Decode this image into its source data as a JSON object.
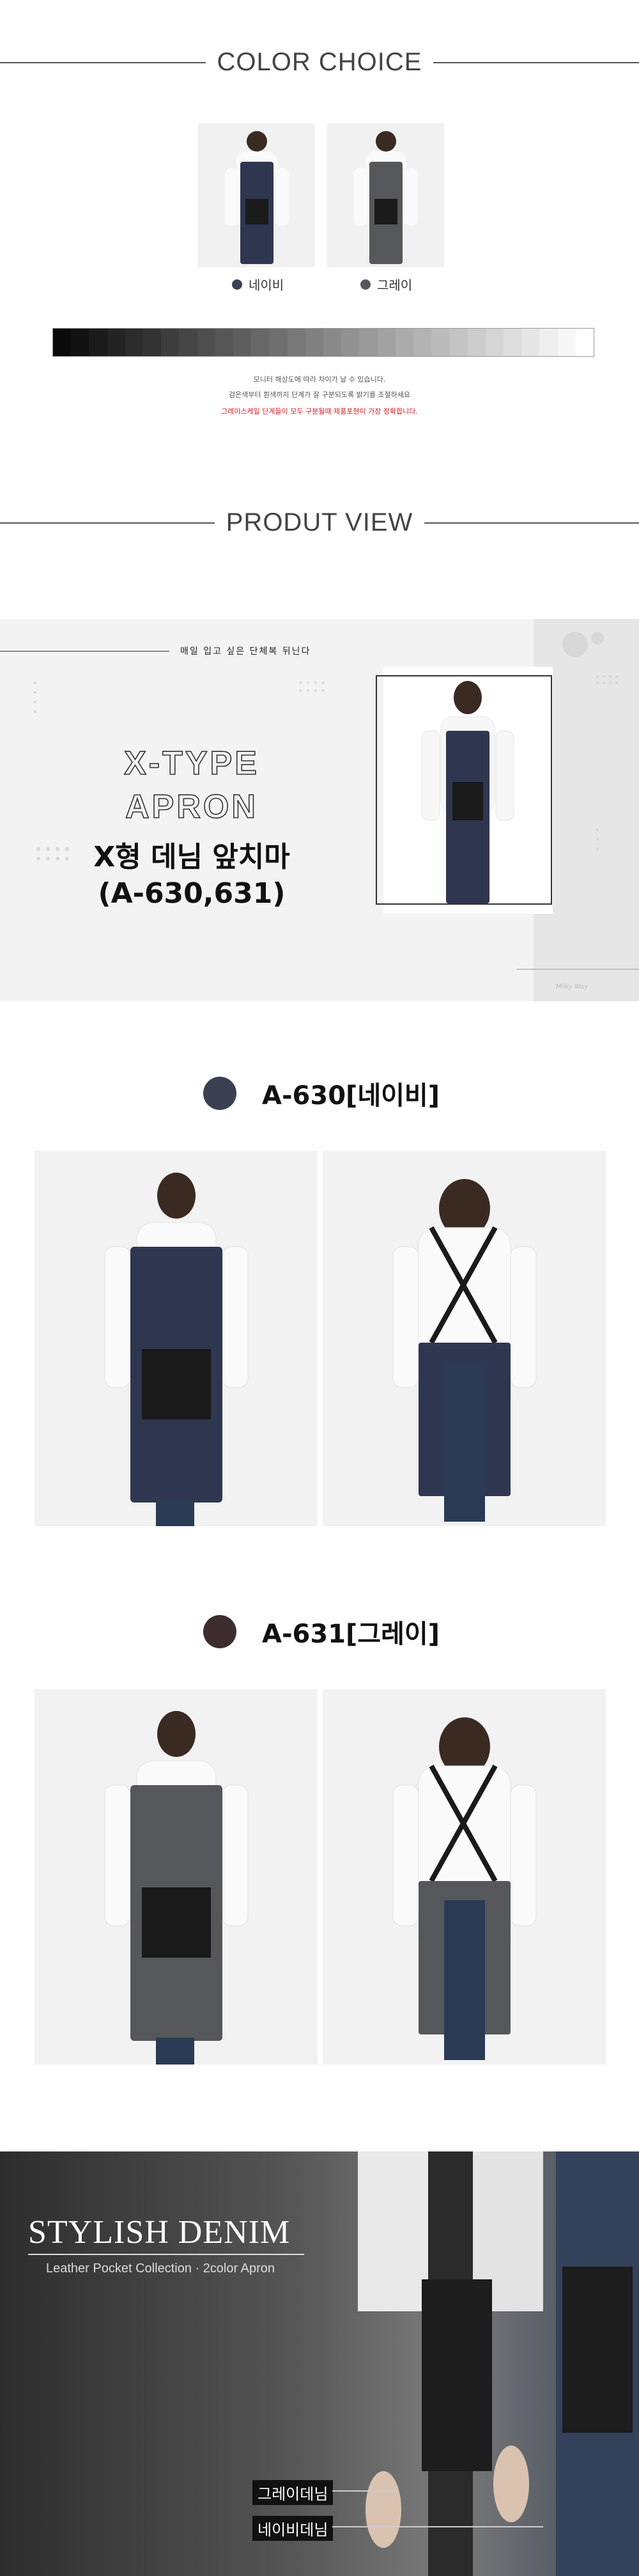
{
  "color_choice": {
    "title": "COLOR CHOICE",
    "options": [
      {
        "label": "네이비",
        "color": "#3a3f52",
        "apron": "#2f3650"
      },
      {
        "label": "그레이",
        "color": "#55575c",
        "apron": "#56575a"
      }
    ],
    "notes": [
      "모니터 해상도에 따라 차이가 날 수 있습니다.",
      "검은색부터 흰색까지 단계가 잘 구분되도록 밝기를 조절하세요",
      "그레이스케일 단계들이 모두 구분될때 제품포현이 가장 정확합니다."
    ]
  },
  "product_view": {
    "title": "PRODUT VIEW"
  },
  "hero": {
    "tagline": "매일 입고 싶은 단체복 뒤닌다",
    "title_en_1": "X-TYPE",
    "title_en_2": "APRON",
    "title_kr": "X형 데님 앞치마",
    "model_codes": "(A-630,631)",
    "watermark": "Milky Way"
  },
  "models": [
    {
      "title": "A-630[네이비]",
      "dot_color": "#3a3f52",
      "apron": "#2f3650"
    },
    {
      "title": "A-631[그레이]",
      "dot_color": "#3d2d2e",
      "apron": "#56575a"
    }
  ],
  "stylish": {
    "title": "STYLISH DENIM",
    "subtitle": "Leather Pocket Collection · 2color Apron",
    "label_gray": "그레이데님",
    "label_navy": "네이비데님"
  }
}
